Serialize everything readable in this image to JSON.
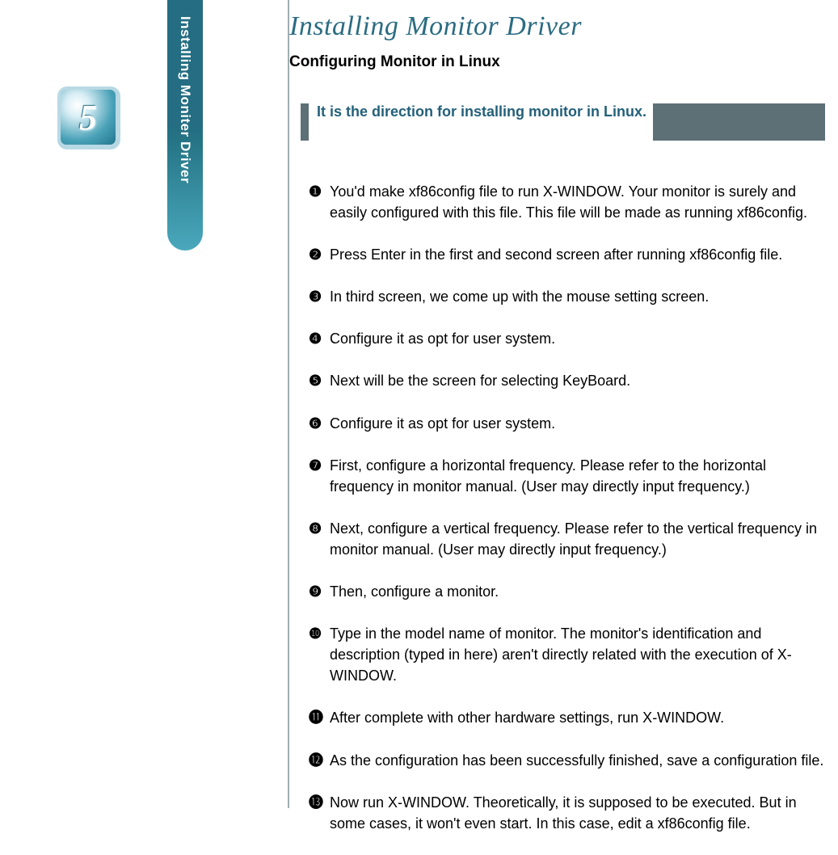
{
  "chapter_number": "5",
  "side_tab_label": "Installing Moniter Driver",
  "page_title": "Installing Monitor Driver",
  "subtitle": "Configuring Monitor in Linux",
  "callout": "It is the direction for installing monitor in Linux.",
  "steps": [
    {
      "marker": "❶",
      "text": "You'd make xf86config file to run X-WINDOW. Your monitor is surely and easily configured with this file. This file will be made as running xf86config."
    },
    {
      "marker": "❷",
      "text": "Press Enter in the first and second screen after running xf86config file."
    },
    {
      "marker": "❸",
      "text": "In third screen, we come up with the mouse setting screen."
    },
    {
      "marker": "❹",
      "text": "Configure it as opt for user system."
    },
    {
      "marker": "❺",
      "text": "Next will be the screen for selecting KeyBoard."
    },
    {
      "marker": "❻",
      "text": "Configure it as opt for user system."
    },
    {
      "marker": "❼",
      "text": "First, configure a horizontal frequency. Please refer to the horizontal frequency in monitor manual. (User may directly input frequency.)"
    },
    {
      "marker": "❽",
      "text": "Next, configure a vertical frequency.  Please refer to the vertical frequency  in monitor manual. (User may directly input frequency.)"
    },
    {
      "marker": "❾",
      "text": "Then, configure a monitor."
    },
    {
      "marker": "❿",
      "text": "Type in the model name of monitor. The monitor's identification and description (typed  in  here) aren't directly related with the execution of X-WINDOW."
    },
    {
      "marker": "⓫",
      "text": "After complete with other hardware settings, run X-WINDOW."
    },
    {
      "marker": "⓬",
      "text": "As the configuration has been successfully finished, save a configuration file."
    },
    {
      "marker": "⓭",
      "text": "Now run X-WINDOW.  Theoretically, it is supposed  to be executed. But  in some cases, it won't even start. In this case, edit a xf86config file."
    }
  ]
}
